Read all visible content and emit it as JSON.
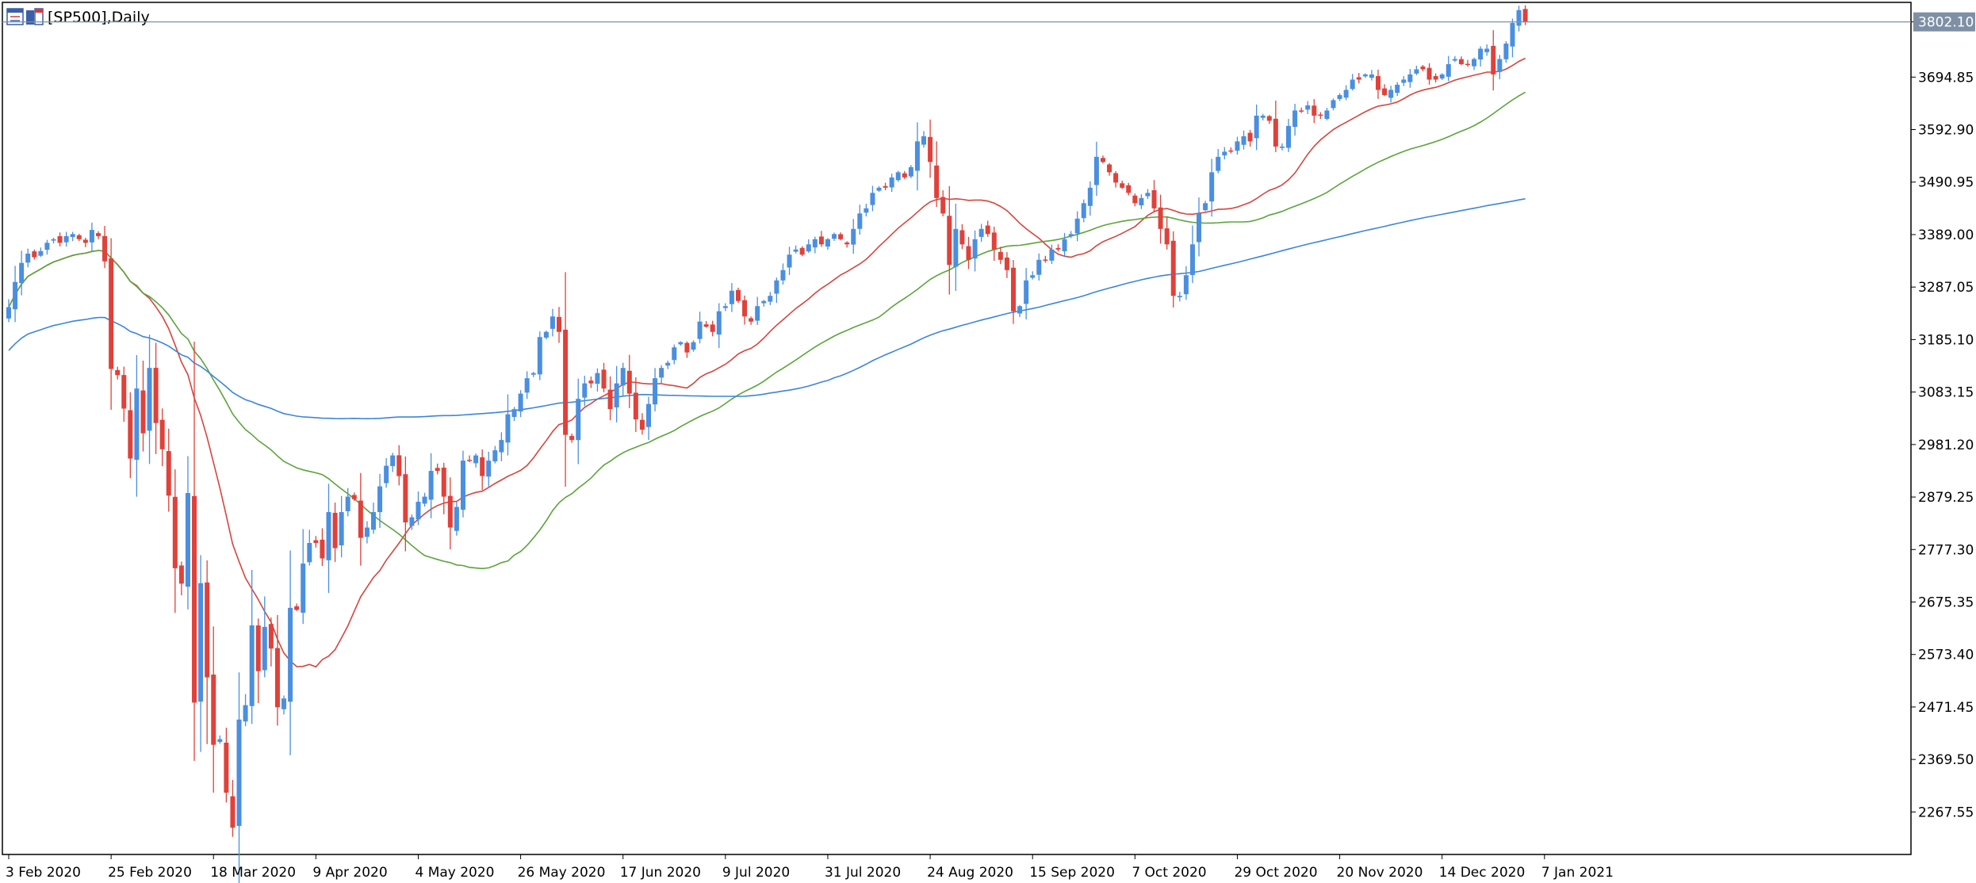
{
  "window": {
    "title": "[SP500],Daily",
    "icons": [
      "chart-window-icon",
      "chart-properties-icon"
    ]
  },
  "colors": {
    "background": "#ffffff",
    "frame": "#000000",
    "bull": "#4a8fe0",
    "bear": "#e0413a",
    "ma_fast": "#d6453d",
    "ma_mid": "#5aa53a",
    "ma_slow": "#3c86d8",
    "price_line": "#7f8fa6",
    "price_tag_bg": "#7f8fa6"
  },
  "chart_data": {
    "type": "candlestick",
    "symbol": "SP500",
    "timeframe": "Daily",
    "ylim": [
      2185.0,
      3840.0
    ],
    "y_ticks": [
      "3802.10",
      "3694.85",
      "3592.90",
      "3490.95",
      "3389.00",
      "3287.05",
      "3185.10",
      "3083.15",
      "2981.20",
      "2879.25",
      "2777.30",
      "2675.35",
      "2573.40",
      "2471.45",
      "2369.50",
      "2267.55"
    ],
    "x_ticks": [
      {
        "label": "3 Feb 2020",
        "bar": 0
      },
      {
        "label": "25 Feb 2020",
        "bar": 16
      },
      {
        "label": "18 Mar 2020",
        "bar": 32
      },
      {
        "label": "9 Apr 2020",
        "bar": 48
      },
      {
        "label": "4 May 2020",
        "bar": 64
      },
      {
        "label": "26 May 2020",
        "bar": 80
      },
      {
        "label": "17 Jun 2020",
        "bar": 96
      },
      {
        "label": "9 Jul 2020",
        "bar": 112
      },
      {
        "label": "31 Jul 2020",
        "bar": 128
      },
      {
        "label": "24 Aug 2020",
        "bar": 144
      },
      {
        "label": "15 Sep 2020",
        "bar": 160
      },
      {
        "label": "7 Oct 2020",
        "bar": 176
      },
      {
        "label": "29 Oct 2020",
        "bar": 192
      },
      {
        "label": "20 Nov 2020",
        "bar": 208
      },
      {
        "label": "14 Dec 2020",
        "bar": 224
      },
      {
        "label": "7 Jan 2021",
        "bar": 240
      }
    ],
    "current_price": "3802.10",
    "closes": [
      3248,
      3297,
      3334,
      3352,
      3345,
      3357,
      3373,
      3380,
      3373,
      3386,
      3390,
      3380,
      3373,
      3398,
      3386,
      3337,
      3128,
      3116,
      3051,
      2954,
      3090,
      3003,
      3130,
      3023,
      2972,
      2882,
      2741,
      2711,
      2887,
      2480,
      2712,
      2529,
      2398,
      2409,
      2305,
      2237,
      2447,
      2475,
      2630,
      2541,
      2627,
      2585,
      2471,
      2488,
      2664,
      2660,
      2750,
      2790,
      2790,
      2760,
      2850,
      2780,
      2850,
      2880,
      2875,
      2800,
      2820,
      2850,
      2900,
      2940,
      2960,
      2920,
      2830,
      2840,
      2870,
      2880,
      2930,
      2930,
      2880,
      2820,
      2860,
      2950,
      2950,
      2960,
      2920,
      2950,
      2970,
      2990,
      3040,
      3050,
      3080,
      3110,
      3120,
      3190,
      3200,
      3230,
      3200,
      3000,
      2990,
      3070,
      3100,
      3100,
      3120,
      3090,
      3050,
      3100,
      3130,
      3080,
      3030,
      3010,
      3060,
      3110,
      3130,
      3140,
      3170,
      3180,
      3160,
      3180,
      3220,
      3210,
      3200,
      3240,
      3250,
      3280,
      3260,
      3230,
      3220,
      3250,
      3260,
      3270,
      3300,
      3320,
      3350,
      3360,
      3350,
      3370,
      3380,
      3370,
      3380,
      3390,
      3380,
      3370,
      3400,
      3430,
      3440,
      3470,
      3480,
      3480,
      3500,
      3510,
      3500,
      3520,
      3570,
      3580,
      3530,
      3460,
      3430,
      3330,
      3400,
      3370,
      3340,
      3380,
      3400,
      3390,
      3360,
      3340,
      3320,
      3240,
      3250,
      3300,
      3310,
      3340,
      3340,
      3360,
      3360,
      3380,
      3390,
      3420,
      3450,
      3480,
      3540,
      3530,
      3510,
      3490,
      3480,
      3470,
      3450,
      3460,
      3470,
      3440,
      3400,
      3370,
      3270,
      3270,
      3310,
      3370,
      3430,
      3450,
      3510,
      3540,
      3550,
      3550,
      3570,
      3580,
      3570,
      3620,
      3620,
      3610,
      3560,
      3560,
      3600,
      3630,
      3630,
      3640,
      3620,
      3620,
      3630,
      3650,
      3660,
      3670,
      3690,
      3690,
      3700,
      3700,
      3670,
      3660,
      3670,
      3680,
      3690,
      3700,
      3710,
      3710,
      3690,
      3690,
      3700,
      3720,
      3730,
      3720,
      3720,
      3730,
      3750,
      3750,
      3700,
      3730,
      3760,
      3800,
      3825,
      3803
    ]
  }
}
